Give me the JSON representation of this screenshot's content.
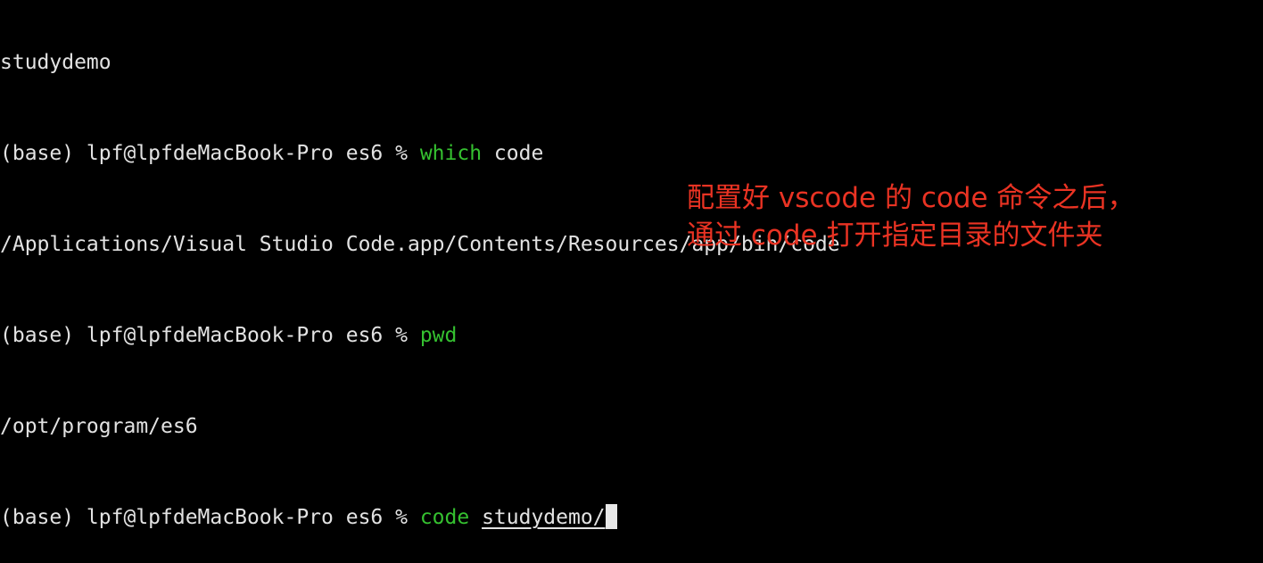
{
  "terminal": {
    "lines": [
      {
        "text": "studydemo"
      },
      {
        "prompt": "(base) lpf@lpfdeMacBook-Pro es6 % ",
        "command": "which",
        "args": " code"
      },
      {
        "text": "/Applications/Visual Studio Code.app/Contents/Resources/app/bin/code"
      },
      {
        "prompt": "(base) lpf@lpfdeMacBook-Pro es6 % ",
        "command": "pwd",
        "args": ""
      },
      {
        "text": "/opt/program/es6"
      },
      {
        "prompt": "(base) lpf@lpfdeMacBook-Pro es6 % ",
        "command": "code",
        "args_space": " ",
        "underlined_arg": "studydemo/"
      }
    ],
    "colors": {
      "background": "#000000",
      "text": "#e2e2e2",
      "command": "#35c130",
      "cursor": "#e8e8e8"
    }
  },
  "annotation": {
    "line1": "配置好 vscode 的 code 命令之后，",
    "line2": "通过 code 打开指定目录的文件夹",
    "color": "#ea3323"
  }
}
